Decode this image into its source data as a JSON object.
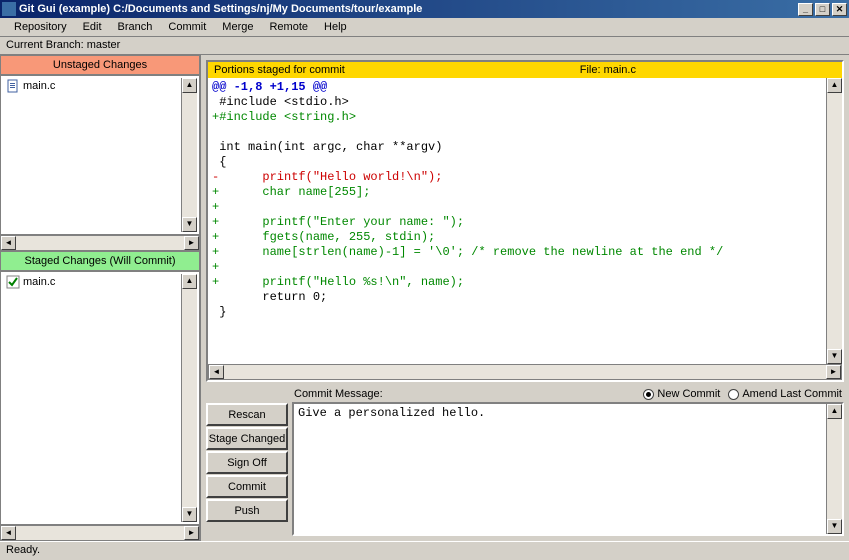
{
  "window": {
    "title": "Git Gui (example) C:/Documents and Settings/nj/My Documents/tour/example"
  },
  "menu": {
    "items": [
      "Repository",
      "Edit",
      "Branch",
      "Commit",
      "Merge",
      "Remote",
      "Help"
    ]
  },
  "branch": {
    "label": "Current Branch:  master"
  },
  "unstaged": {
    "header": "Unstaged Changes",
    "files": [
      "main.c"
    ]
  },
  "staged": {
    "header": "Staged Changes (Will Commit)",
    "files": [
      "main.c"
    ]
  },
  "diff": {
    "header_left": "Portions staged for commit",
    "header_right": "File:  main.c",
    "lines": [
      {
        "cls": "hunk",
        "text": "@@ -1,8 +1,15 @@"
      },
      {
        "cls": "ctx",
        "text": " #include <stdio.h>"
      },
      {
        "cls": "add",
        "text": "+#include <string.h>"
      },
      {
        "cls": "ctx",
        "text": " "
      },
      {
        "cls": "ctx",
        "text": " int main(int argc, char **argv)"
      },
      {
        "cls": "ctx",
        "text": " {"
      },
      {
        "cls": "del",
        "text": "-      printf(\"Hello world!\\n\");"
      },
      {
        "cls": "add",
        "text": "+      char name[255];"
      },
      {
        "cls": "add",
        "text": "+"
      },
      {
        "cls": "add",
        "text": "+      printf(\"Enter your name: \");"
      },
      {
        "cls": "add",
        "text": "+      fgets(name, 255, stdin);"
      },
      {
        "cls": "add",
        "text": "+      name[strlen(name)-1] = '\\0'; /* remove the newline at the end */"
      },
      {
        "cls": "add",
        "text": "+"
      },
      {
        "cls": "add",
        "text": "+      printf(\"Hello %s!\\n\", name);"
      },
      {
        "cls": "ctx",
        "text": "       return 0;"
      },
      {
        "cls": "ctx",
        "text": " }"
      }
    ]
  },
  "commit": {
    "message_label": "Commit Message:",
    "new_commit": "New Commit",
    "amend": "Amend Last Commit",
    "message": "Give a personalized hello."
  },
  "buttons": {
    "rescan": "Rescan",
    "stage_changed": "Stage Changed",
    "sign_off": "Sign Off",
    "commit": "Commit",
    "push": "Push"
  },
  "status": {
    "text": "Ready."
  }
}
